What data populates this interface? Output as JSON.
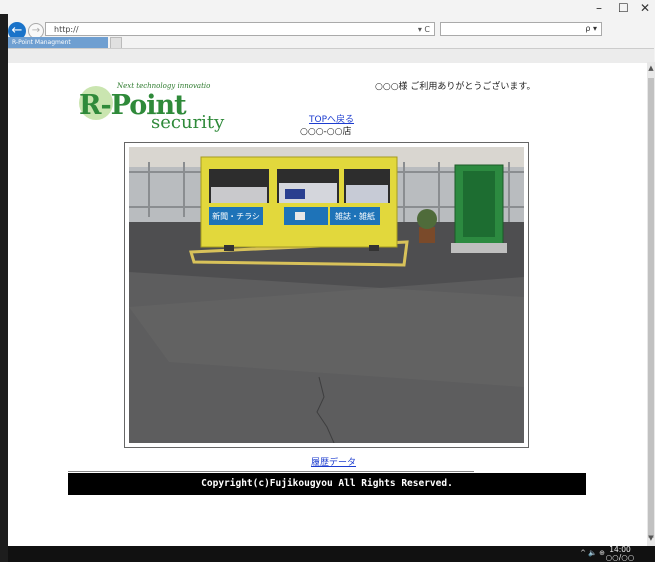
{
  "browser": {
    "address_url": "http://",
    "address_icons": "▾ C",
    "search_icon": "ρ ▾",
    "tab_title": "R-Point Managment",
    "window_controls": {
      "minimize": "–",
      "maximize": "☐",
      "close": "✕"
    }
  },
  "logo": {
    "tagline": "Next technology innovatio",
    "main": "R-Point",
    "sub": "security"
  },
  "greeting": "○○○様  ご利用ありがとうございます。",
  "top_link": "TOPへ戻る",
  "store_name": "○○○-○○店",
  "camera": {
    "sign_left": "新聞・チラシ",
    "sign_right": "雑誌・雑紙"
  },
  "history_link": "履歴データ",
  "footer": "Copyright(c)Fujikougyou All Rights Reserved.",
  "taskbar": {
    "tray_icons": "^ 🔈 ⊕",
    "time": "14:00",
    "date": "○○/○○"
  },
  "colors": {
    "link": "#1c3ccf",
    "logo_green": "#2f8a3a",
    "tab_blue": "#6f9fd1",
    "footer_bg": "#000000"
  }
}
